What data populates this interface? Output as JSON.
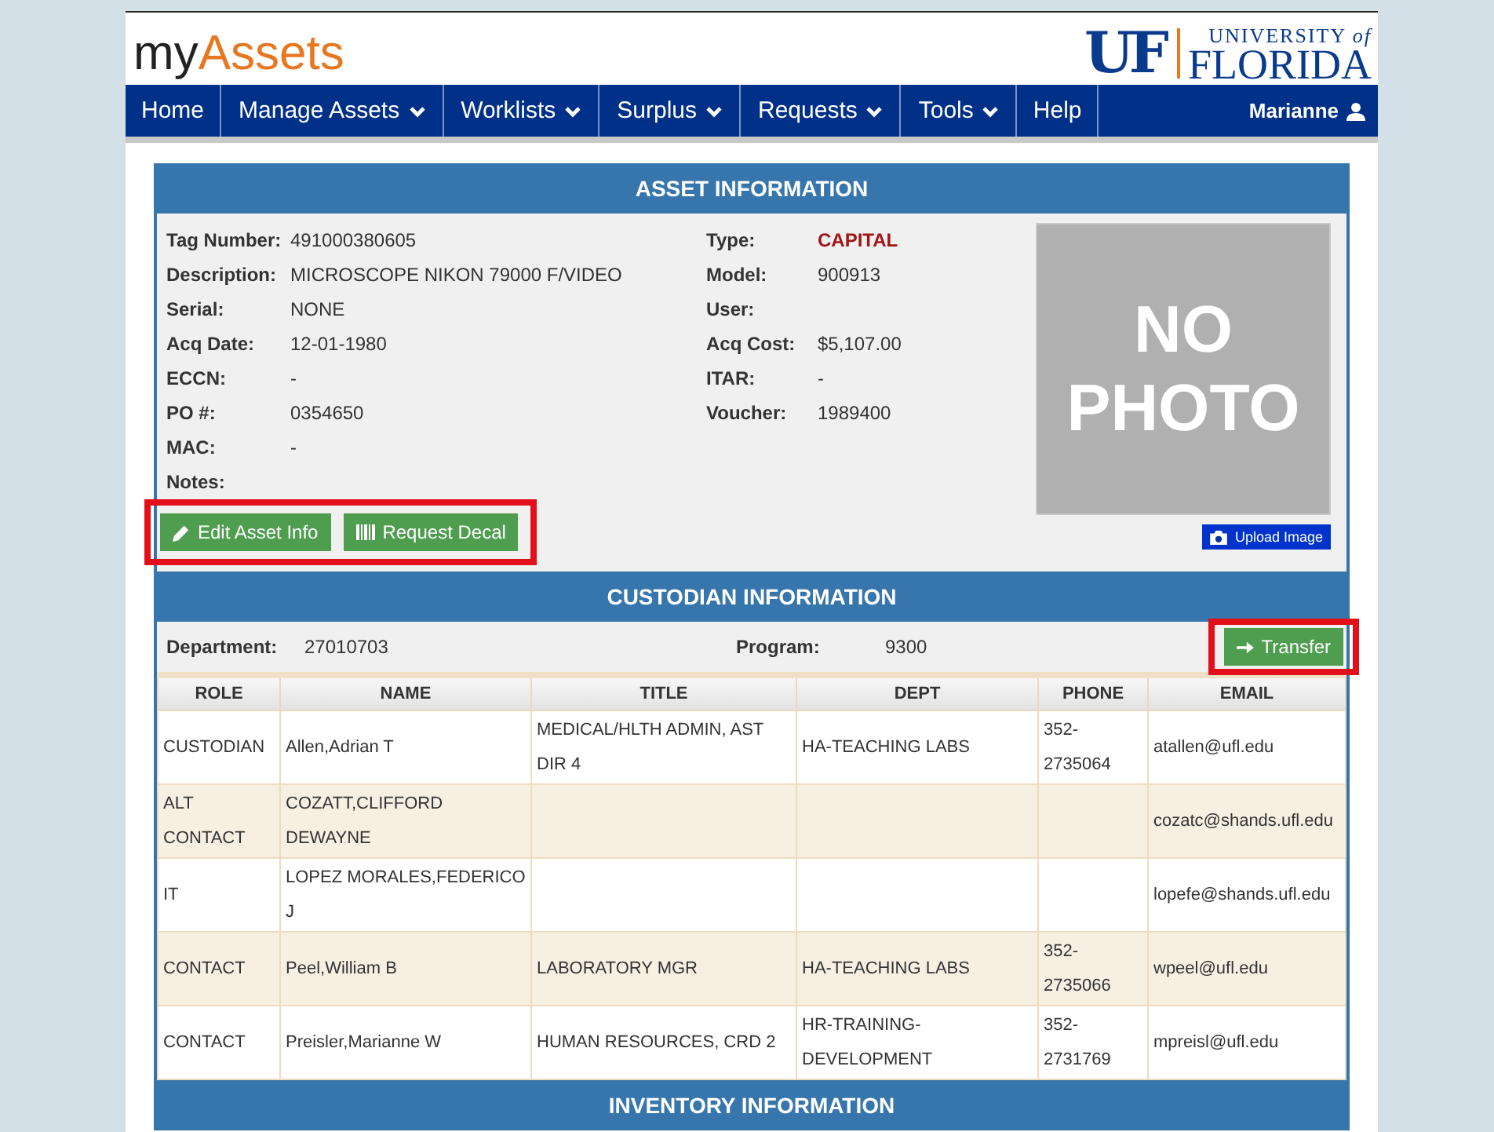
{
  "header": {
    "app_name_prefix": "my",
    "app_name_suffix": "Assets",
    "logo_mark": "UF",
    "logo_line1": "UNIVERSITY ",
    "logo_line1_italic": "of",
    "logo_line2": "FLORIDA"
  },
  "nav": {
    "items": [
      {
        "label": "Home",
        "dropdown": false
      },
      {
        "label": "Manage Assets",
        "dropdown": true
      },
      {
        "label": "Worklists",
        "dropdown": true
      },
      {
        "label": "Surplus",
        "dropdown": true
      },
      {
        "label": "Requests",
        "dropdown": true
      },
      {
        "label": "Tools",
        "dropdown": true
      },
      {
        "label": "Help",
        "dropdown": false
      }
    ],
    "user": "Marianne"
  },
  "asset_information": {
    "title": "ASSET INFORMATION",
    "left_fields": [
      {
        "label": "Tag Number:",
        "value": "491000380605"
      },
      {
        "label": "Description:",
        "value": "MICROSCOPE NIKON 79000 F/VIDEO"
      },
      {
        "label": "Serial:",
        "value": "NONE"
      },
      {
        "label": "Acq Date:",
        "value": "12-01-1980"
      },
      {
        "label": "ECCN:",
        "value": "-"
      },
      {
        "label": "PO #:",
        "value": "0354650"
      },
      {
        "label": "MAC:",
        "value": "-"
      },
      {
        "label": "Notes:"
      }
    ],
    "right_fields": [
      {
        "label": "Type:",
        "value": "CAPITAL",
        "kind": "alert"
      },
      {
        "label": "Model:",
        "value": "900913",
        "kind": "plain"
      },
      {
        "label": "User:",
        "kind": "plain"
      },
      {
        "label": "Acq Cost:",
        "value": "$5,107.00",
        "kind": "plain"
      },
      {
        "label": "ITAR:",
        "value": "-",
        "kind": "plain"
      },
      {
        "label": "Voucher:",
        "value": "1989400",
        "kind": "plain"
      }
    ],
    "photo_placeholder": [
      "NO",
      "PHOTO"
    ],
    "upload_button": "Upload Image",
    "buttons": [
      {
        "label": "Edit Asset Info",
        "kind": "edit"
      },
      {
        "label": "Request Decal",
        "kind": "decal"
      }
    ],
    "buttons_highlighted": true
  },
  "custodian_information": {
    "title": "CUSTODIAN INFORMATION",
    "department_label": "Department:",
    "department": "27010703",
    "program_label": "Program:",
    "program": "9300",
    "transfer_button": "Transfer",
    "transfer_highlighted": true,
    "table": {
      "columns": [
        "ROLE",
        "NAME",
        "TITLE",
        "DEPT",
        "PHONE",
        "EMAIL"
      ],
      "rows": [
        [
          "CUSTODIAN",
          "Allen,Adrian T",
          "MEDICAL/HLTH ADMIN, AST DIR 4",
          "HA-TEACHING LABS",
          "352-2735064",
          "atallen@ufl.edu"
        ],
        [
          "ALT CONTACT",
          "COZATT,CLIFFORD DEWAYNE",
          "",
          "",
          "",
          "cozatc@shands.ufl.edu"
        ],
        [
          "IT",
          "LOPEZ MORALES,FEDERICO J",
          "",
          "",
          "",
          "lopefe@shands.ufl.edu"
        ],
        [
          "CONTACT",
          "Peel,William B",
          "LABORATORY MGR",
          "HA-TEACHING LABS",
          "352-2735066",
          "wpeel@ufl.edu"
        ],
        [
          "CONTACT",
          "Preisler,Marianne W",
          "HUMAN RESOURCES, CRD 2",
          "HR-TRAINING-DEVELOPMENT",
          "352-2731769",
          "mpreisl@ufl.edu"
        ]
      ]
    }
  },
  "inventory_information": {
    "title": "INVENTORY INFORMATION"
  }
}
